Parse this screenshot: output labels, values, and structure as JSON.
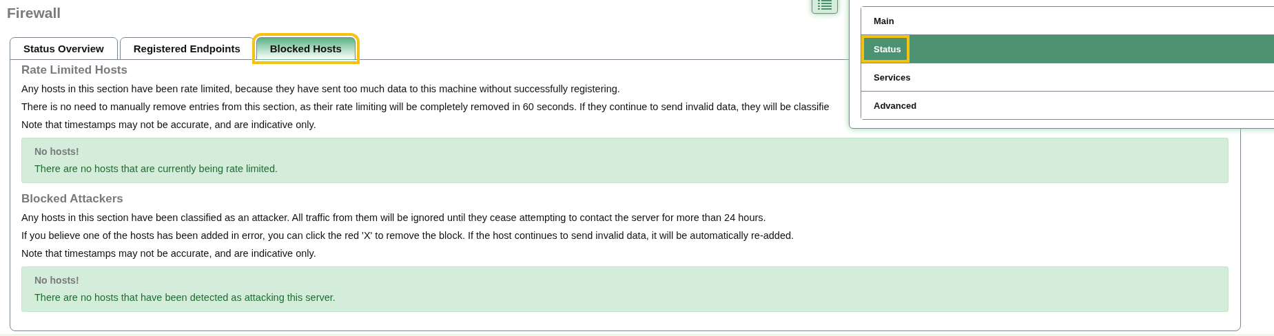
{
  "page": {
    "title": "Firewall"
  },
  "tabs": [
    {
      "label": "Status Overview",
      "selected": false,
      "highlighted": false
    },
    {
      "label": "Registered Endpoints",
      "selected": false,
      "highlighted": false
    },
    {
      "label": "Blocked Hosts",
      "selected": true,
      "highlighted": true
    }
  ],
  "sections": [
    {
      "heading": "Rate Limited Hosts",
      "paragraphs": [
        "Any hosts in this section have been rate limited, because they have sent too much data to this machine without successfully registering.",
        "There is no need to manually remove entries from this section, as their rate limiting will be completely removed in 60 seconds. If they continue to send invalid data, they will be classifie",
        "Note that timestamps may not be accurate, and are indicative only."
      ],
      "alert": {
        "title": "No hosts!",
        "message": "There are no hosts that are currently being rate limited."
      }
    },
    {
      "heading": "Blocked Attackers",
      "paragraphs": [
        "Any hosts in this section have been classified as an attacker. All traffic from them will be ignored until they cease attempting to contact the server for more than 24 hours.",
        "If you believe one of the hosts has been added in error, you can click the red 'X' to remove the block. If the host continues to send invalid data, it will be automatically re-added.",
        "Note that timestamps may not be accurate, and are indicative only."
      ],
      "alert": {
        "title": "No hosts!",
        "message": "There are no hosts that have been detected as attacking this server."
      }
    }
  ],
  "menu": {
    "items": [
      {
        "label": "Main",
        "selected": false,
        "highlighted": false
      },
      {
        "label": "Status",
        "selected": true,
        "highlighted": true
      },
      {
        "label": "Services",
        "selected": false,
        "highlighted": false
      },
      {
        "label": "Advanced",
        "selected": false,
        "highlighted": false
      }
    ]
  }
}
